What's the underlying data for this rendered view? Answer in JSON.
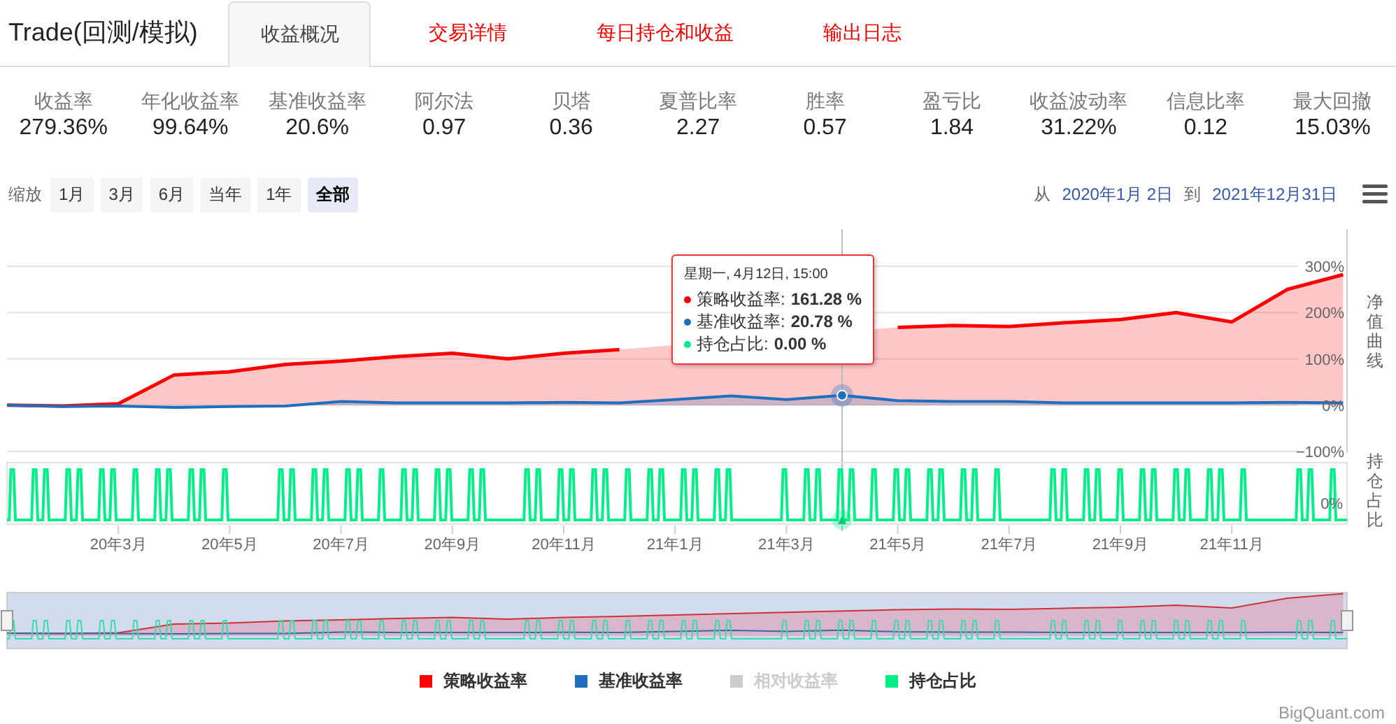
{
  "title": "Trade(回测/模拟)",
  "tabs": [
    {
      "label": "收益概况",
      "selected": true
    },
    {
      "label": "交易详情",
      "selected": false
    },
    {
      "label": "每日持仓和收益",
      "selected": false
    },
    {
      "label": "输出日志",
      "selected": false
    }
  ],
  "stats": [
    {
      "label": "收益率",
      "value": "279.36%"
    },
    {
      "label": "年化收益率",
      "value": "99.64%"
    },
    {
      "label": "基准收益率",
      "value": "20.6%"
    },
    {
      "label": "阿尔法",
      "value": "0.97"
    },
    {
      "label": "贝塔",
      "value": "0.36"
    },
    {
      "label": "夏普比率",
      "value": "2.27"
    },
    {
      "label": "胜率",
      "value": "0.57"
    },
    {
      "label": "盈亏比",
      "value": "1.84"
    },
    {
      "label": "收益波动率",
      "value": "31.22%"
    },
    {
      "label": "信息比率",
      "value": "0.12"
    },
    {
      "label": "最大回撤",
      "value": "15.03%"
    }
  ],
  "zoom": {
    "label": "缩放",
    "buttons": [
      {
        "label": "1月",
        "selected": false
      },
      {
        "label": "3月",
        "selected": false
      },
      {
        "label": "6月",
        "selected": false
      },
      {
        "label": "当年",
        "selected": false
      },
      {
        "label": "1年",
        "selected": false
      },
      {
        "label": "全部",
        "selected": true
      }
    ]
  },
  "date_range": {
    "from_label": "从",
    "from": "2020年1月 2日",
    "to_label": "到",
    "to": "2021年12月31日"
  },
  "chart_data": {
    "type": "area",
    "ylabel": "净值曲线",
    "categories": [
      null,
      null,
      "20年3月",
      null,
      "20年5月",
      null,
      "20年7月",
      null,
      "20年9月",
      null,
      "20年11月",
      null,
      "21年1月",
      null,
      "21年3月",
      null,
      "21年5月",
      null,
      "21年7月",
      null,
      "21年9月",
      null,
      "21年11月",
      null,
      null
    ],
    "series": [
      {
        "name": "策略收益率",
        "color": "#ff0000",
        "values": [
          0,
          -2,
          3,
          65,
          72,
          88,
          95,
          105,
          112,
          100,
          112,
          120,
          null,
          null,
          null,
          null,
          168,
          172,
          170,
          178,
          185,
          200,
          180,
          250,
          282
        ]
      },
      {
        "name": "基准收益率",
        "color": "#1f6fbf",
        "values": [
          0,
          -3,
          -2,
          -5,
          -3,
          -2,
          8,
          5,
          5,
          5,
          6,
          5,
          12,
          20,
          12,
          21,
          10,
          8,
          8,
          5,
          5,
          5,
          5,
          6,
          5
        ]
      }
    ],
    "ylim": [
      -100,
      380
    ],
    "grid": true,
    "yticks": [
      {
        "value": 300,
        "label": "300%"
      },
      {
        "value": 200,
        "label": "200%"
      },
      {
        "value": 100,
        "label": "100%"
      },
      {
        "value": 0,
        "label": "0%"
      },
      {
        "value": -100,
        "label": "−100%"
      }
    ]
  },
  "holdings_panel": {
    "title": "持仓占比",
    "tick": "0%"
  },
  "tooltip": {
    "header": "星期一, 4月12日, 15:00",
    "rows": [
      {
        "name": "策略收益率:",
        "value": "161.28 %",
        "color": "#ff0000"
      },
      {
        "name": "基准收益率:",
        "value": "20.78 %",
        "color": "#1f6fbf"
      },
      {
        "name": "持仓占比:",
        "value": "0.00 %",
        "color": "#00ee88"
      }
    ]
  },
  "legend": [
    {
      "name": "相对收益率",
      "color": "#cccccc",
      "visible": false
    },
    {
      "name": "持仓占比",
      "color": "#00ee88",
      "visible": true
    }
  ],
  "credits": "BigQuant.com"
}
